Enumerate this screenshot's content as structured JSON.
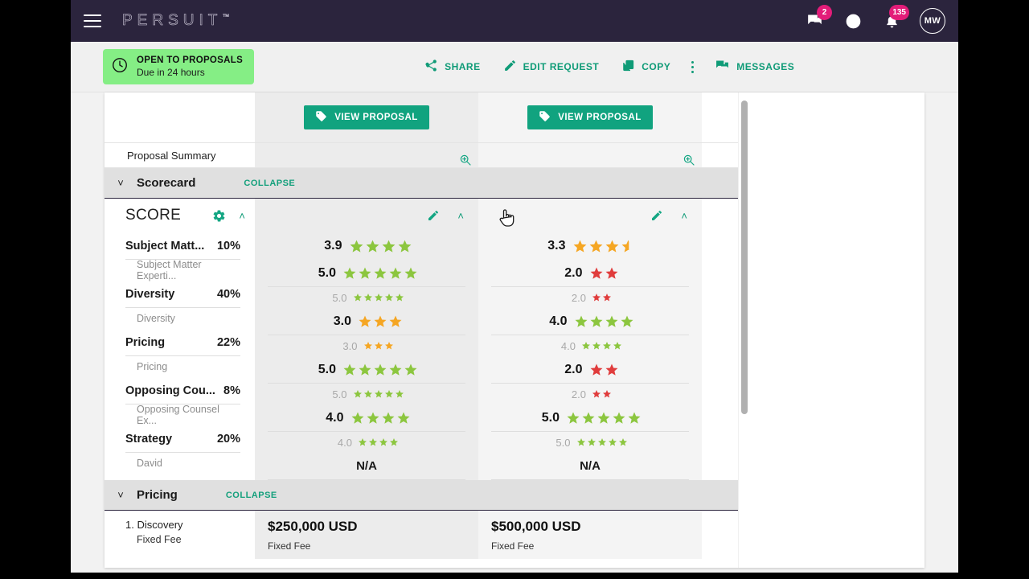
{
  "topbar": {
    "brand": "PERSUIT",
    "brand_tm": "™",
    "menu_icon": "hamburger-menu-icon",
    "chat_badge": "2",
    "help_icon": "help-circle-icon",
    "bell_badge": "135",
    "avatar_initials": "MW"
  },
  "actionbar": {
    "status_title": "OPEN TO PROPOSALS",
    "status_sub": "Due in 24 hours",
    "share_label": "SHARE",
    "edit_label": "EDIT REQUEST",
    "copy_label": "COPY",
    "messages_label": "MESSAGES",
    "more_icon": "kebab-menu-icon"
  },
  "comparison": {
    "view_proposal_label": "VIEW PROPOSAL",
    "summary_label": "Proposal Summary",
    "zoom_icon": "magnify-plus-icon"
  },
  "scorecard": {
    "section_name": "Scorecard",
    "collapse_label": "COLLAPSE",
    "score_label": "SCORE",
    "gear_icon": "gear-icon",
    "pencil_icon": "pencil-icon",
    "caret_icon": "chevron-up-icon",
    "criteria": [
      {
        "name": "Subject Matt...",
        "weight": "10%",
        "sub": "Subject Matter Experti..."
      },
      {
        "name": "Diversity",
        "weight": "40%",
        "sub": "Diversity"
      },
      {
        "name": "Pricing",
        "weight": "22%",
        "sub": "Pricing"
      },
      {
        "name": "Opposing Cou...",
        "weight": "8%",
        "sub": "Opposing Counsel Ex..."
      },
      {
        "name": "Strategy",
        "weight": "20%",
        "sub": "David"
      }
    ],
    "proposals": [
      {
        "total": "3.9",
        "total_stars": 4,
        "total_color": "#8cc63f",
        "na_label": "N/A",
        "ratings": [
          {
            "main": "5.0",
            "main_stars": 5,
            "sub": "5.0",
            "sub_stars": 5,
            "color": "#8cc63f"
          },
          {
            "main": "3.0",
            "main_stars": 3,
            "sub": "3.0",
            "sub_stars": 3,
            "color": "#f5a623"
          },
          {
            "main": "5.0",
            "main_stars": 5,
            "sub": "5.0",
            "sub_stars": 5,
            "color": "#8cc63f"
          },
          {
            "main": "4.0",
            "main_stars": 4,
            "sub": "4.0",
            "sub_stars": 4,
            "color": "#8cc63f"
          }
        ]
      },
      {
        "total": "3.3",
        "total_stars": 3.5,
        "total_color": "#f5a623",
        "na_label": "N/A",
        "ratings": [
          {
            "main": "2.0",
            "main_stars": 2,
            "sub": "2.0",
            "sub_stars": 2,
            "color": "#e03c3c"
          },
          {
            "main": "4.0",
            "main_stars": 4,
            "sub": "4.0",
            "sub_stars": 4,
            "color": "#8cc63f"
          },
          {
            "main": "2.0",
            "main_stars": 2,
            "sub": "2.0",
            "sub_stars": 2,
            "color": "#e03c3c"
          },
          {
            "main": "5.0",
            "main_stars": 5,
            "sub": "5.0",
            "sub_stars": 5,
            "color": "#8cc63f"
          }
        ]
      }
    ]
  },
  "pricing": {
    "section_name": "Pricing",
    "collapse_label": "COLLAPSE",
    "rows": [
      {
        "index": "1.",
        "name": "Discovery",
        "sub": "Fixed Fee",
        "values": [
          {
            "amount": "$250,000 USD",
            "type": "Fixed Fee"
          },
          {
            "amount": "$500,000 USD",
            "type": "Fixed Fee"
          }
        ]
      }
    ]
  },
  "colors": {
    "brand_dark": "#2b243d",
    "accent_green": "#11a37f",
    "badge_pink": "#e31c79",
    "status_green": "#85ee85",
    "star_good": "#8cc63f",
    "star_mid": "#f5a623",
    "star_bad": "#e03c3c"
  }
}
